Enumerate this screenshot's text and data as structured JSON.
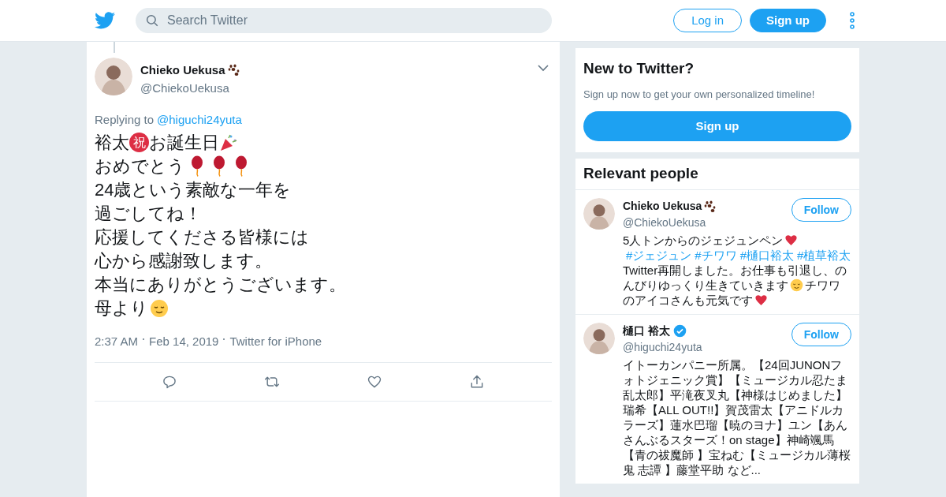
{
  "header": {
    "search": {
      "placeholder": "Search Twitter"
    },
    "buttons": [
      {
        "label": "Log in",
        "kind": "outline"
      },
      {
        "label": "Sign up",
        "kind": "filled"
      }
    ]
  },
  "tweet": {
    "name": "Chieko Uekusa",
    "handle": "@ChiekoUekusa",
    "badge": {
      "kind": "paw"
    },
    "replying_label": "Replying to",
    "replying_to": "@higuchi24yuta",
    "lines": [
      [
        {
          "kind": "text",
          "text": "裕太"
        },
        {
          "kind": "circled",
          "text": "祝"
        },
        {
          "kind": "text",
          "text": "お誕生日"
        },
        {
          "kind": "party"
        }
      ],
      [
        {
          "kind": "text",
          "text": "おめでとう"
        },
        {
          "kind": "balloon"
        },
        {
          "kind": "balloon"
        },
        {
          "kind": "balloon"
        }
      ],
      [
        {
          "kind": "text",
          "text": "24歳という素敵な一年を"
        }
      ],
      [
        {
          "kind": "text",
          "text": "過ごしてね！"
        }
      ],
      [
        {
          "kind": "text",
          "text": "応援してくださる皆様には"
        }
      ],
      [
        {
          "kind": "text",
          "text": "心から感謝致します。"
        }
      ],
      [
        {
          "kind": "text",
          "text": "本当にありがとうございます。"
        }
      ],
      [
        {
          "kind": "text",
          "text": "母より"
        },
        {
          "kind": "smile"
        }
      ]
    ],
    "meta": [
      "2:37 AM",
      "Feb 14, 2019",
      "Twitter for iPhone"
    ],
    "actions": [
      {
        "kind": "reply"
      },
      {
        "kind": "retweet"
      },
      {
        "kind": "like"
      },
      {
        "kind": "share"
      }
    ]
  },
  "signup_card": {
    "title": "New to Twitter?",
    "text": "Sign up now to get your own personalized timeline!",
    "button": "Sign up"
  },
  "relevant": {
    "title": "Relevant people",
    "people": [
      {
        "name": "Chieko Uekusa",
        "badge": {
          "kind": "paw"
        },
        "handle": "@ChiekoUekusa",
        "button": "Follow",
        "bio": [
          {
            "kind": "text",
            "text": "5人トンからのジェジュンペン"
          },
          {
            "kind": "heart"
          },
          {
            "kind": "link",
            "text": "#ジェジュン"
          },
          {
            "kind": "link",
            "text": "#チワワ"
          },
          {
            "kind": "link",
            "text": "#樋口裕太"
          },
          {
            "kind": "link",
            "text": "#植草裕太"
          },
          {
            "kind": "text",
            "text": " Twitter再開しました。お仕事も引退し、のんびりゆっくり生きていきます"
          },
          {
            "kind": "smile"
          },
          {
            "kind": "text",
            "text": "チワワのアイコさんも元気です"
          },
          {
            "kind": "heart"
          }
        ]
      },
      {
        "name": "樋口 裕太",
        "badge": {
          "kind": "verified"
        },
        "handle": "@higuchi24yuta",
        "button": "Follow",
        "bio": [
          {
            "kind": "text",
            "text": "イトーカンパニー所属。【24回JUNONフォトジェニック賞】【ミュージカル忍たま乱太郎】平滝夜叉丸【神様はじめました】瑞希【ALL OUT!!】賀茂雷太【アニドルカラーズ】蓮水巴瑠【暁のヨナ】ユン【あんさんぶるスターズ！on stage】神崎颯馬【青の祓魔師 】宝ねむ【ミュージカル薄桜鬼 志譚 】藤堂平助 など..."
          }
        ]
      }
    ]
  }
}
